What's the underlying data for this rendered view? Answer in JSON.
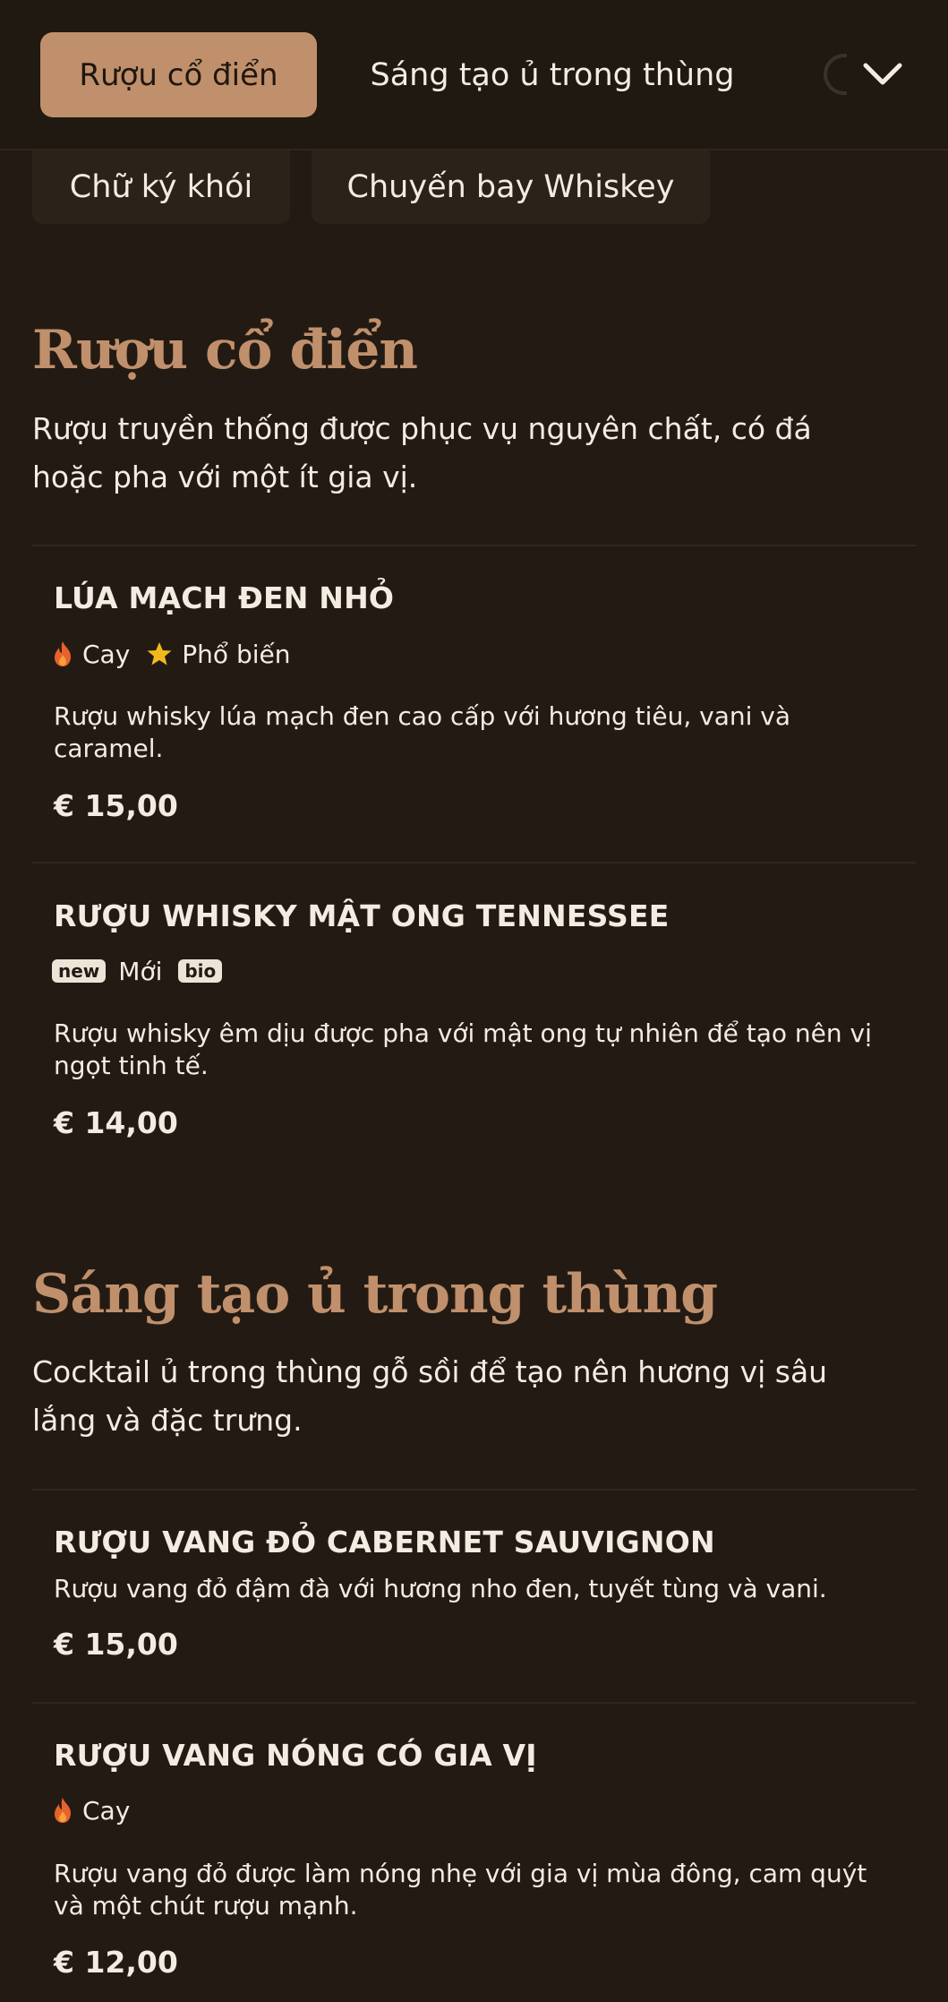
{
  "categories": {
    "active_label": "Rượu cổ điển",
    "tab2_label": "Sáng tạo ủ trong thùng",
    "chip1_label": "Chữ ký khói",
    "chip2_label": "Chuyến bay Whiskey",
    "more_icon": "chevron-down-icon"
  },
  "sections": [
    {
      "title": "Rượu cổ điển",
      "description": "Rượu truyền thống được phục vụ nguyên chất, có đá hoặc pha với một ít gia vị.",
      "items": [
        {
          "name": "LÚA MẠCH ĐEN NHỎ",
          "tags": {
            "spicy": "Cay",
            "popular": "Phổ biến"
          },
          "description": "Rượu whisky lúa mạch đen cao cấp với hương tiêu, vani và caramel.",
          "price": "€ 15,00"
        },
        {
          "name": "RƯỢU WHISKY MẬT ONG TENNESSEE",
          "tags": {
            "new_badge": "new",
            "new": "Mới",
            "bio_badge": "bio"
          },
          "description": "Rượu whisky êm dịu được pha với mật ong tự nhiên để tạo nên vị ngọt tinh tế.",
          "price": "€ 14,00"
        }
      ]
    },
    {
      "title": "Sáng tạo ủ trong thùng",
      "description": "Cocktail ủ trong thùng gỗ sồi để tạo nên hương vị sâu lắng và đặc trưng.",
      "items": [
        {
          "name": "RƯỢU VANG ĐỎ CABERNET SAUVIGNON",
          "description": "Rượu vang đỏ đậm đà với hương nho đen, tuyết tùng và vani.",
          "price": "€ 15,00"
        },
        {
          "name": "RƯỢU VANG NÓNG CÓ GIA VỊ",
          "tags": {
            "spicy": "Cay"
          },
          "description": "Rượu vang đỏ được làm nóng nhẹ với gia vị mùa đông, cam quýt và một chút rượu mạnh.",
          "price": "€ 12,00"
        }
      ]
    }
  ],
  "colors": {
    "background": "#231b13",
    "accent": "#c0906c",
    "text": "#f3ece2",
    "flame": "#e8622c",
    "star": "#f2b91c"
  }
}
